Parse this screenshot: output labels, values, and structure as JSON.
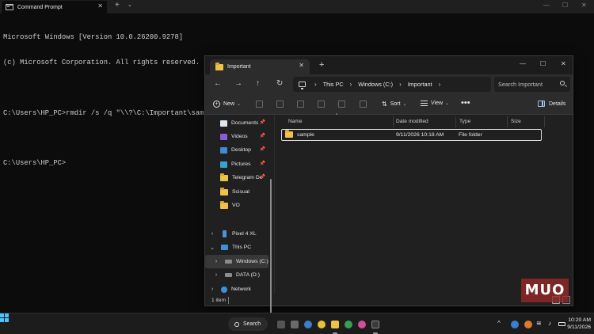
{
  "cmd": {
    "tab_title": "Command Prompt",
    "lines": [
      "Microsoft Windows [Version 10.0.26200.9278]",
      "(c) Microsoft Corporation. All rights reserved.",
      "",
      "C:\\Users\\HP_PC>rmdir /s /q \"\\\\?\\C:\\Important\\sample.\"",
      "",
      "C:\\Users\\HP_PC>"
    ]
  },
  "explorer": {
    "tab_title": "Important",
    "breadcrumbs": [
      "This PC",
      "Windows (C:)",
      "Important"
    ],
    "search_placeholder": "Search Important",
    "toolbar": {
      "new_label": "New",
      "sort_label": "Sort",
      "view_label": "View",
      "details_label": "Details"
    },
    "nav": {
      "quick_access": [
        {
          "label": "Documents",
          "icon": "documents-icon",
          "pinned": true
        },
        {
          "label": "Videos",
          "icon": "videos-icon",
          "pinned": true
        },
        {
          "label": "Desktop",
          "icon": "desktop-icon",
          "pinned": true
        },
        {
          "label": "Pictures",
          "icon": "pictures-icon",
          "pinned": true
        },
        {
          "label": "Telegram De",
          "icon": "folder-icon",
          "pinned": true
        },
        {
          "label": "Scisual",
          "icon": "folder-icon",
          "pinned": false
        },
        {
          "label": "VO",
          "icon": "folder-icon",
          "pinned": false
        }
      ],
      "devices": [
        {
          "label": "Pixel 4 XL",
          "icon": "phone-icon"
        },
        {
          "label": "This PC",
          "icon": "this-pc-icon"
        },
        {
          "label": "Windows (C:)",
          "icon": "drive-icon"
        },
        {
          "label": "DATA (D:)",
          "icon": "drive-icon"
        },
        {
          "label": "Network",
          "icon": "network-icon"
        }
      ]
    },
    "columns": [
      "Name",
      "Date modified",
      "Type",
      "Size"
    ],
    "files": [
      {
        "name": "sample",
        "date_modified": "9/11/2026 10:18 AM",
        "type": "File folder",
        "size": ""
      }
    ],
    "status": "1 item"
  },
  "watermark": "MUO",
  "taskbar": {
    "search_label": "Search",
    "time": "10:20 AM",
    "date": "9/11/2026"
  },
  "colors": {
    "terminal_bg": "#0c0c0c",
    "explorer_bg": "#202020",
    "accent": "#4cc2ff",
    "folder": "#f0c24a"
  }
}
